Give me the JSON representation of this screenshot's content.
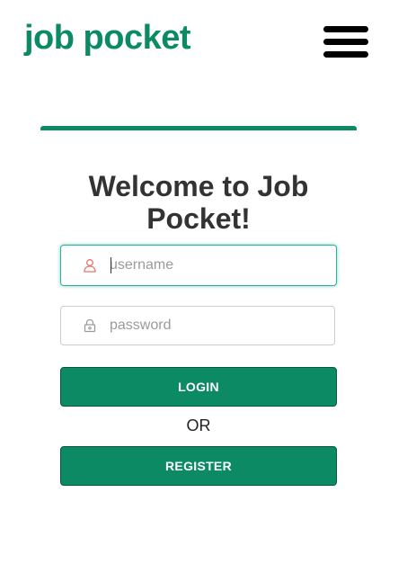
{
  "header": {
    "brand": "job pocket",
    "menu_icon": "hamburger-menu-icon"
  },
  "colors": {
    "brand": "#0b8a63",
    "title": "#333333",
    "focus": "#2bb0a0",
    "user_icon": "#e8736a"
  },
  "login": {
    "title": "Welcome to Job Pocket!",
    "username": {
      "value": "",
      "placeholder": "username",
      "icon": "user-icon"
    },
    "password": {
      "value": "",
      "placeholder": "password",
      "icon": "lock-icon"
    },
    "login_label": "LOGIN",
    "or_label": "OR",
    "register_label": "REGISTER"
  }
}
